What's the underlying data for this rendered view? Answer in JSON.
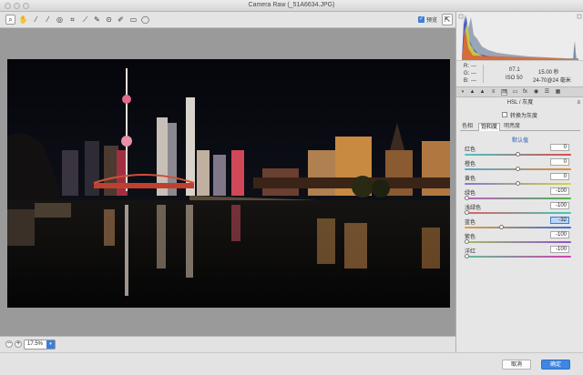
{
  "window": {
    "title": "Camera Raw (_51A6634.JPG)"
  },
  "toolbar": {
    "tools": [
      {
        "icon": "zoom-icon"
      },
      {
        "icon": "hand-icon"
      },
      {
        "icon": "white-balance-icon"
      },
      {
        "icon": "color-sampler-icon"
      },
      {
        "icon": "targeted-adjustment-icon"
      },
      {
        "icon": "crop-icon"
      },
      {
        "icon": "straighten-icon"
      },
      {
        "icon": "spot-removal-icon"
      },
      {
        "icon": "red-eye-icon"
      },
      {
        "icon": "adjustment-brush-icon"
      },
      {
        "icon": "graduated-filter-icon"
      },
      {
        "icon": "radial-filter-icon"
      }
    ],
    "preview_label": "预览",
    "preview_checked": true
  },
  "zoom": {
    "value": "17.5%"
  },
  "readout": {
    "r": "R:",
    "g": "G:",
    "b": "B:",
    "dash": "---",
    "aperture": "f/7.1",
    "shutter": "15.00 秒",
    "iso": "ISO 50",
    "lens": "24-70@24 毫米"
  },
  "panel": {
    "title": "HSL / 灰度",
    "convert_gray_label": "转换为灰度",
    "convert_gray_checked": false,
    "subtabs": [
      {
        "label": "色相"
      },
      {
        "label": "饱和度"
      },
      {
        "label": "明亮度"
      }
    ],
    "default_link": "默认值",
    "sliders": [
      {
        "label": "红色",
        "value": "0",
        "fraction": 0.5,
        "color_from": "#4bc4c7",
        "color_to": "#e04a4a"
      },
      {
        "label": "橙色",
        "value": "0",
        "fraction": 0.5,
        "color_from": "#5aa8d8",
        "color_to": "#e88a30"
      },
      {
        "label": "黄色",
        "value": "0",
        "fraction": 0.5,
        "color_from": "#7a7ad8",
        "color_to": "#e0d040"
      },
      {
        "label": "绿色",
        "value": "-100",
        "fraction": 0.0,
        "color_from": "#c060c0",
        "color_to": "#4ab850"
      },
      {
        "label": "浅绿色",
        "value": "-100",
        "fraction": 0.0,
        "color_from": "#e06060",
        "color_to": "#40c8c0"
      },
      {
        "label": "蓝色",
        "value": "-32",
        "fraction": 0.34,
        "color_from": "#e0a040",
        "color_to": "#3a6ee0"
      },
      {
        "label": "紫色",
        "value": "-100",
        "fraction": 0.0,
        "color_from": "#a0c060",
        "color_to": "#9050d0"
      },
      {
        "label": "洋红",
        "value": "-100",
        "fraction": 0.0,
        "color_from": "#60c090",
        "color_to": "#d040b0"
      }
    ]
  },
  "footer": {
    "cancel_label": "取消",
    "ok_label": "确定"
  },
  "colors": {
    "accent": "#3d86e4",
    "canvas_gray": "#9a9a9a"
  }
}
